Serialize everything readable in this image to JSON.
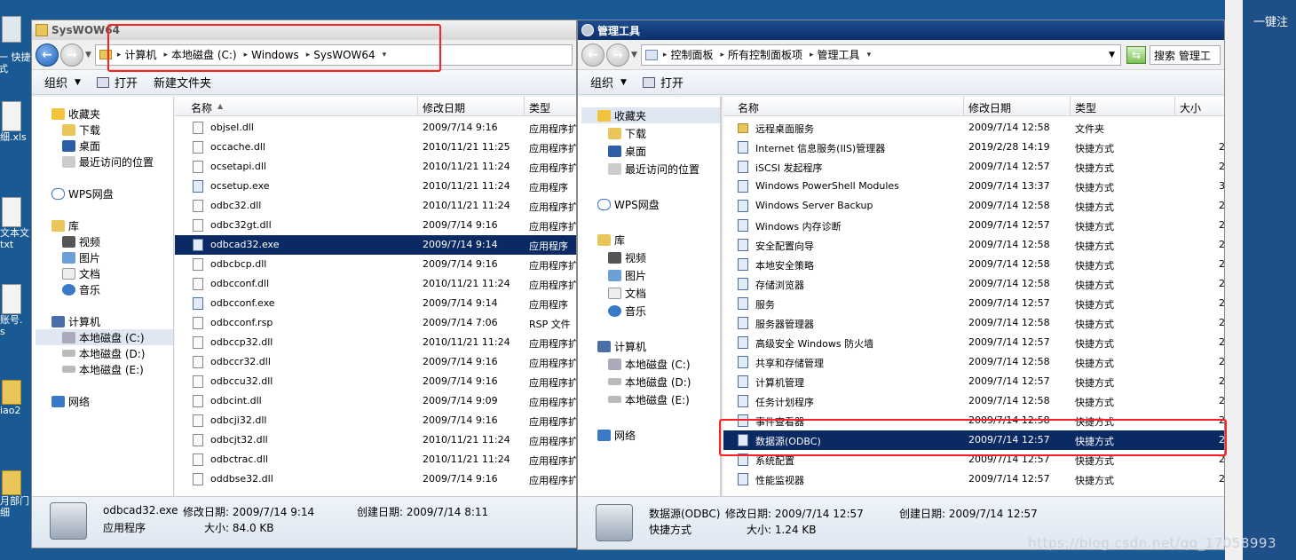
{
  "desktop": {
    "left_labels": [
      "一 快捷",
      "式",
      "细.xls",
      "文本文",
      "txt",
      "账号.",
      "s",
      "iao2",
      "月部门",
      "细"
    ],
    "right_label": "一键注"
  },
  "left_window": {
    "title": "SysWOW64",
    "breadcrumb": [
      "计算机",
      "本地磁盘 (C:)",
      "Windows",
      "SysWOW64"
    ],
    "toolbar": {
      "organize": "组织",
      "open": "打开",
      "new_folder": "新建文件夹"
    },
    "nav": [
      "收藏夹",
      "下载",
      "桌面",
      "最近访问的位置",
      "WPS网盘",
      "库",
      "视频",
      "图片",
      "文档",
      "音乐",
      "计算机",
      "本地磁盘 (C:)",
      "本地磁盘 (D:)",
      "本地磁盘 (E:)",
      "网络"
    ],
    "columns": {
      "name": "名称",
      "date": "修改日期",
      "type": "类型"
    },
    "files": [
      {
        "name": "objsel.dll",
        "date": "2009/7/14 9:16",
        "type": "应用程序扩"
      },
      {
        "name": "occache.dll",
        "date": "2010/11/21 11:25",
        "type": "应用程序扩"
      },
      {
        "name": "ocsetapi.dll",
        "date": "2010/11/21 11:24",
        "type": "应用程序扩"
      },
      {
        "name": "ocsetup.exe",
        "date": "2010/11/21 11:24",
        "type": "应用程序"
      },
      {
        "name": "odbc32.dll",
        "date": "2010/11/21 11:24",
        "type": "应用程序扩"
      },
      {
        "name": "odbc32gt.dll",
        "date": "2009/7/14 9:16",
        "type": "应用程序扩"
      },
      {
        "name": "odbcad32.exe",
        "date": "2009/7/14 9:14",
        "type": "应用程序"
      },
      {
        "name": "odbcbcp.dll",
        "date": "2009/7/14 9:16",
        "type": "应用程序扩"
      },
      {
        "name": "odbcconf.dll",
        "date": "2010/11/21 11:24",
        "type": "应用程序扩"
      },
      {
        "name": "odbcconf.exe",
        "date": "2009/7/14 9:14",
        "type": "应用程序"
      },
      {
        "name": "odbcconf.rsp",
        "date": "2009/7/14 7:06",
        "type": "RSP 文件"
      },
      {
        "name": "odbccp32.dll",
        "date": "2010/11/21 11:24",
        "type": "应用程序扩"
      },
      {
        "name": "odbccr32.dll",
        "date": "2009/7/14 9:16",
        "type": "应用程序扩"
      },
      {
        "name": "odbccu32.dll",
        "date": "2009/7/14 9:16",
        "type": "应用程序扩"
      },
      {
        "name": "odbcint.dll",
        "date": "2009/7/14 9:09",
        "type": "应用程序扩"
      },
      {
        "name": "odbcji32.dll",
        "date": "2009/7/14 9:16",
        "type": "应用程序扩"
      },
      {
        "name": "odbcjt32.dll",
        "date": "2010/11/21 11:24",
        "type": "应用程序扩"
      },
      {
        "name": "odbctrac.dll",
        "date": "2010/11/21 11:24",
        "type": "应用程序扩"
      },
      {
        "name": "oddbse32.dll",
        "date": "2009/7/14 9:16",
        "type": "应用程序扩"
      }
    ],
    "status": {
      "name": "odbcad32.exe",
      "modified_label": "修改日期: 2009/7/14 9:14",
      "created_label": "创建日期: 2009/7/14 8:11",
      "type": "应用程序",
      "size_label": "大小: 84.0 KB"
    }
  },
  "right_window": {
    "title": "管理工具",
    "breadcrumb": [
      "控制面板",
      "所有控制面板项",
      "管理工具"
    ],
    "search_placeholder": "搜索 管理工",
    "toolbar": {
      "organize": "组织",
      "open": "打开"
    },
    "nav": [
      "收藏夹",
      "下载",
      "桌面",
      "最近访问的位置",
      "WPS网盘",
      "库",
      "视频",
      "图片",
      "文档",
      "音乐",
      "计算机",
      "本地磁盘 (C:)",
      "本地磁盘 (D:)",
      "本地磁盘 (E:)",
      "网络"
    ],
    "columns": {
      "name": "名称",
      "date": "修改日期",
      "type": "类型",
      "size": "大小"
    },
    "files": [
      {
        "name": "远程桌面服务",
        "date": "2009/7/14 12:58",
        "type": "文件夹",
        "size": ""
      },
      {
        "name": "Internet 信息服务(IIS)管理器",
        "date": "2019/2/28 14:19",
        "type": "快捷方式",
        "size": "2"
      },
      {
        "name": "iSCSI 发起程序",
        "date": "2009/7/14 12:57",
        "type": "快捷方式",
        "size": "2"
      },
      {
        "name": "Windows PowerShell Modules",
        "date": "2009/7/14 13:37",
        "type": "快捷方式",
        "size": "3"
      },
      {
        "name": "Windows Server Backup",
        "date": "2009/7/14 12:58",
        "type": "快捷方式",
        "size": "2"
      },
      {
        "name": "Windows 内存诊断",
        "date": "2009/7/14 12:57",
        "type": "快捷方式",
        "size": "2"
      },
      {
        "name": "安全配置向导",
        "date": "2009/7/14 12:58",
        "type": "快捷方式",
        "size": "2"
      },
      {
        "name": "本地安全策略",
        "date": "2009/7/14 12:58",
        "type": "快捷方式",
        "size": "2"
      },
      {
        "name": "存储浏览器",
        "date": "2009/7/14 12:58",
        "type": "快捷方式",
        "size": "2"
      },
      {
        "name": "服务",
        "date": "2009/7/14 12:57",
        "type": "快捷方式",
        "size": "2"
      },
      {
        "name": "服务器管理器",
        "date": "2009/7/14 12:58",
        "type": "快捷方式",
        "size": "2"
      },
      {
        "name": "高级安全 Windows 防火墙",
        "date": "2009/7/14 12:57",
        "type": "快捷方式",
        "size": "2"
      },
      {
        "name": "共享和存储管理",
        "date": "2009/7/14 12:58",
        "type": "快捷方式",
        "size": "2"
      },
      {
        "name": "计算机管理",
        "date": "2009/7/14 12:57",
        "type": "快捷方式",
        "size": "2"
      },
      {
        "name": "任务计划程序",
        "date": "2009/7/14 12:58",
        "type": "快捷方式",
        "size": "2"
      },
      {
        "name": "事件查看器",
        "date": "2009/7/14 12:58",
        "type": "快捷方式",
        "size": "2"
      },
      {
        "name": "数据源(ODBC)",
        "date": "2009/7/14 12:57",
        "type": "快捷方式",
        "size": "2"
      },
      {
        "name": "系统配置",
        "date": "2009/7/14 12:57",
        "type": "快捷方式",
        "size": "2"
      },
      {
        "name": "性能监视器",
        "date": "2009/7/14 12:57",
        "type": "快捷方式",
        "size": "2"
      }
    ],
    "status": {
      "name": "数据源(ODBC)",
      "modified_label": "修改日期: 2009/7/14 12:57",
      "created_label": "创建日期: 2009/7/14 12:57",
      "type": "快捷方式",
      "size_label": "大小: 1.24 KB"
    }
  },
  "watermark": "https://blog.csdn.net/qq_17058993",
  "colors": {
    "selection": "#0b2a63",
    "highlight_box": "#ff2020",
    "desktop": "#1a5a94"
  }
}
